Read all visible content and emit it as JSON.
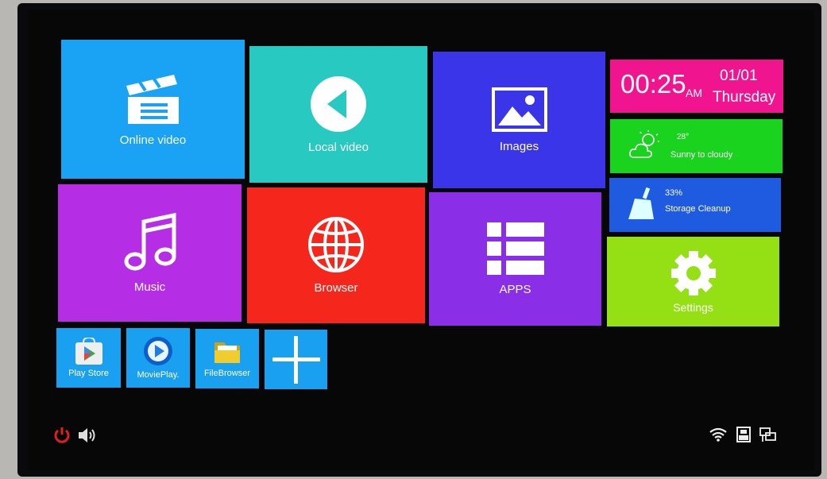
{
  "tiles": [
    {
      "label": "Online video",
      "icon": "clapperboard-icon",
      "color": "#1aa3f5"
    },
    {
      "label": "Local video",
      "icon": "play-back-icon",
      "color": "#27c9c0"
    },
    {
      "label": "Images",
      "icon": "image-icon",
      "color": "#3a35e8"
    },
    {
      "label": "Music",
      "icon": "music-note-icon",
      "color": "#b52ee6"
    },
    {
      "label": "Browser",
      "icon": "globe-icon",
      "color": "#f5261b"
    },
    {
      "label": "APPS",
      "icon": "apps-list-icon",
      "color": "#8a2ee8"
    }
  ],
  "clock": {
    "time": "00:25",
    "ampm": "AM",
    "date": "01/01",
    "day": "Thursday",
    "color": "#f0148f"
  },
  "weather": {
    "temp": "28°",
    "desc": "Sunny to cloudy",
    "icon": "sun-cloud-icon",
    "color": "#19d31f"
  },
  "storage": {
    "percent": "33%",
    "label": "Storage Cleanup",
    "icon": "broom-icon",
    "color": "#1e5be0"
  },
  "settings": {
    "label": "Settings",
    "icon": "gear-icon",
    "color": "#95e014"
  },
  "shortcuts": [
    {
      "label": "Play Store",
      "icon": "play-store-icon"
    },
    {
      "label": "MoviePlay.",
      "icon": "movie-player-icon"
    },
    {
      "label": "FileBrowser",
      "icon": "folder-icon"
    },
    {
      "label": "",
      "icon": "plus-icon"
    }
  ],
  "shortcut_color": "#1aa0f0",
  "status": {
    "left": [
      "power-icon",
      "volume-icon"
    ],
    "right": [
      "wifi-icon",
      "usb-icon",
      "ethernet-icon"
    ]
  }
}
